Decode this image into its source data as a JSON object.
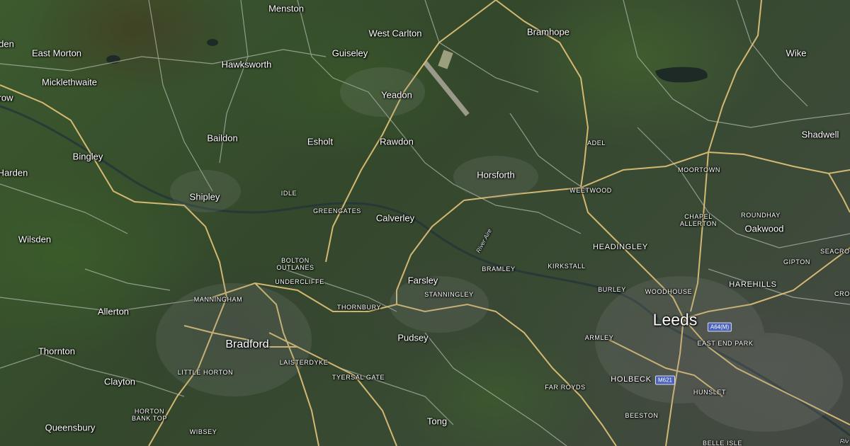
{
  "map": {
    "places": [
      {
        "id": "menston",
        "name": "Menston",
        "cls": "town"
      },
      {
        "id": "west-carlton",
        "name": "West Carlton",
        "cls": "town"
      },
      {
        "id": "bramhope",
        "name": "Bramhope",
        "cls": "town"
      },
      {
        "id": "east-morton",
        "name": "East Morton",
        "cls": "town"
      },
      {
        "id": "guiseley",
        "name": "Guiseley",
        "cls": "town"
      },
      {
        "id": "wike",
        "name": "Wike",
        "cls": "town"
      },
      {
        "id": "hawksworth",
        "name": "Hawksworth",
        "cls": "town"
      },
      {
        "id": "micklethwaite",
        "name": "Micklethwaite",
        "cls": "town"
      },
      {
        "id": "yeadon",
        "name": "Yeadon",
        "cls": "town"
      },
      {
        "id": "baildon",
        "name": "Baildon",
        "cls": "town"
      },
      {
        "id": "esholt",
        "name": "Esholt",
        "cls": "town"
      },
      {
        "id": "rawdon",
        "name": "Rawdon",
        "cls": "town"
      },
      {
        "id": "shadwell",
        "name": "Shadwell",
        "cls": "town"
      },
      {
        "id": "bingley",
        "name": "Bingley",
        "cls": "town"
      },
      {
        "id": "horsforth",
        "name": "Horsforth",
        "cls": "town"
      },
      {
        "id": "shipley",
        "name": "Shipley",
        "cls": "town"
      },
      {
        "id": "calverley",
        "name": "Calverley",
        "cls": "town"
      },
      {
        "id": "oakwood",
        "name": "Oakwood",
        "cls": "town"
      },
      {
        "id": "wilsden",
        "name": "Wilsden",
        "cls": "town"
      },
      {
        "id": "farsley",
        "name": "Farsley",
        "cls": "town"
      },
      {
        "id": "allerton",
        "name": "Allerton",
        "cls": "town"
      },
      {
        "id": "pudsey",
        "name": "Pudsey",
        "cls": "town"
      },
      {
        "id": "thornton",
        "name": "Thornton",
        "cls": "town"
      },
      {
        "id": "clayton",
        "name": "Clayton",
        "cls": "town"
      },
      {
        "id": "tong",
        "name": "Tong",
        "cls": "town"
      },
      {
        "id": "queensbury",
        "name": "Queensbury",
        "cls": "town"
      },
      {
        "id": "harden",
        "name": "Harden",
        "cls": "town"
      },
      {
        "id": "den",
        "name": "den",
        "cls": "town"
      },
      {
        "id": "crow",
        "name": "row",
        "cls": "town"
      },
      {
        "id": "adel",
        "name": "ADEL",
        "cls": "district"
      },
      {
        "id": "moortown",
        "name": "MOORTOWN",
        "cls": "district"
      },
      {
        "id": "weetwood",
        "name": "WEETWOOD",
        "cls": "district"
      },
      {
        "id": "idle",
        "name": "IDLE",
        "cls": "district"
      },
      {
        "id": "greengates",
        "name": "GREENGATES",
        "cls": "district"
      },
      {
        "id": "chapel-allerton",
        "name": "CHAPEL\nALLERTON",
        "cls": "district"
      },
      {
        "id": "roundhay",
        "name": "ROUNDHAY",
        "cls": "district"
      },
      {
        "id": "bolton-outlanes",
        "name": "BOLTON\nOUTLANES",
        "cls": "district"
      },
      {
        "id": "gipton",
        "name": "GIPTON",
        "cls": "district"
      },
      {
        "id": "seacroft",
        "name": "SEACROF",
        "cls": "district"
      },
      {
        "id": "bramley",
        "name": "BRAMLEY",
        "cls": "district"
      },
      {
        "id": "kirkstall",
        "name": "KIRKSTALL",
        "cls": "district"
      },
      {
        "id": "undercliffe",
        "name": "UNDERCLIFFE",
        "cls": "district"
      },
      {
        "id": "stanningley",
        "name": "STANNINGLEY",
        "cls": "district"
      },
      {
        "id": "burley",
        "name": "BURLEY",
        "cls": "district"
      },
      {
        "id": "woodhouse",
        "name": "WOODHOUSE",
        "cls": "district"
      },
      {
        "id": "manningham",
        "name": "MANNINGHAM",
        "cls": "district"
      },
      {
        "id": "thornbury",
        "name": "THORNBURY",
        "cls": "district"
      },
      {
        "id": "armley",
        "name": "ARMLEY",
        "cls": "district"
      },
      {
        "id": "east-end-park",
        "name": "EAST END PARK",
        "cls": "district"
      },
      {
        "id": "laisterdyke",
        "name": "LAISTERDYKE",
        "cls": "district"
      },
      {
        "id": "little-horton",
        "name": "LITTLE HORTON",
        "cls": "district"
      },
      {
        "id": "tyersal-gate",
        "name": "TYERSAL GATE",
        "cls": "district"
      },
      {
        "id": "far-royds",
        "name": "FAR ROYDS",
        "cls": "district"
      },
      {
        "id": "hunslet",
        "name": "HUNSLET",
        "cls": "district"
      },
      {
        "id": "horton-bank-top",
        "name": "HORTON\nBANK TOP",
        "cls": "district"
      },
      {
        "id": "beeston",
        "name": "BEESTON",
        "cls": "district"
      },
      {
        "id": "wibsey",
        "name": "WIBSEY",
        "cls": "district"
      },
      {
        "id": "belle-isle",
        "name": "BELLE ISLE",
        "cls": "district"
      },
      {
        "id": "croft",
        "name": "CROF",
        "cls": "district"
      },
      {
        "id": "headingley",
        "name": "HEADINGLEY",
        "cls": "mid"
      },
      {
        "id": "harehills",
        "name": "HAREHILLS",
        "cls": "mid"
      },
      {
        "id": "holbeck",
        "name": "HOLBECK",
        "cls": "mid"
      },
      {
        "id": "leeds",
        "name": "Leeds",
        "cls": "city"
      },
      {
        "id": "bradford",
        "name": "Bradford",
        "cls": "cityl"
      },
      {
        "id": "river-aire",
        "name": "River Aire",
        "cls": "river"
      },
      {
        "id": "river-label",
        "name": "Riv",
        "cls": "river"
      }
    ],
    "shields": [
      {
        "id": "a64m",
        "text": "A64(M)"
      },
      {
        "id": "m621",
        "text": "M621"
      }
    ]
  }
}
